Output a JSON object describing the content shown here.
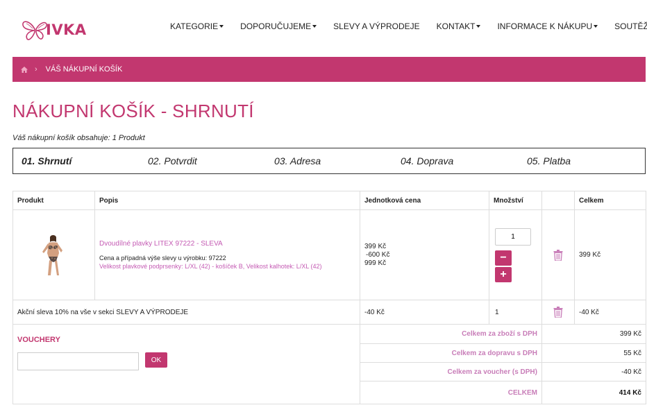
{
  "logo": {
    "text": "IVKA",
    "color": "#c2376f"
  },
  "nav": {
    "items": [
      {
        "label": "KATEGORIE",
        "dropdown": true
      },
      {
        "label": "DOPORUČUJEME",
        "dropdown": true
      },
      {
        "label": "SLEVY A VÝPRODEJE",
        "dropdown": false
      },
      {
        "label": "KONTAKT",
        "dropdown": true
      },
      {
        "label": "INFORMACE K NÁKUPU",
        "dropdown": true
      },
      {
        "label": "SOUTĚŽ",
        "dropdown": false
      }
    ]
  },
  "breadcrumb": {
    "sep": "›",
    "current": "VÁŠ NÁKUPNÍ KOŠÍK"
  },
  "page": {
    "title": "NÁKUPNÍ KOŠÍK - SHRNUTÍ",
    "cart_info": "Váš nákupní košík obsahuje: 1 Produkt"
  },
  "steps": [
    {
      "label": "01. Shrnutí",
      "active": true
    },
    {
      "label": "02. Potvrdit",
      "active": false
    },
    {
      "label": "03. Adresa",
      "active": false
    },
    {
      "label": "04. Doprava",
      "active": false
    },
    {
      "label": "05. Platba",
      "active": false
    }
  ],
  "table": {
    "headers": {
      "product": "Produkt",
      "description": "Popis",
      "unit_price": "Jednotková cena",
      "quantity": "Množství",
      "total": "Celkem"
    },
    "product_row": {
      "name": "Dvoudílné plavky LITEX 97222 - SLEVA",
      "note": "Cena a případná výše slevy u výrobku: 97222",
      "size": "Velikost plavkové podprsenky: L/XL (42) - košíček B, Velikost kalhotek: L/XL (42)",
      "price_original": "399 Kč",
      "price_discount": "-600 Kč",
      "price_final": "999 Kč",
      "quantity": "1",
      "minus": "−",
      "plus": "+",
      "total": "399 Kč"
    },
    "discount_row": {
      "label": "Akční sleva 10% na vše v sekci SLEVY A VÝPRODEJE",
      "price": "-40 Kč",
      "quantity": "1",
      "total": "-40 Kč"
    }
  },
  "vouchers": {
    "label": "VOUCHERY",
    "input_value": "",
    "button": "OK"
  },
  "summary": {
    "goods_label": "Celkem za zboží s DPH",
    "goods_value": "399 Kč",
    "shipping_label": "Celkem za dopravu s DPH",
    "shipping_value": "55 Kč",
    "voucher_label": "Celkem za voucher (s DPH)",
    "voucher_value": "-40 Kč",
    "total_label": "CELKEM",
    "total_value": "414 Kč"
  }
}
